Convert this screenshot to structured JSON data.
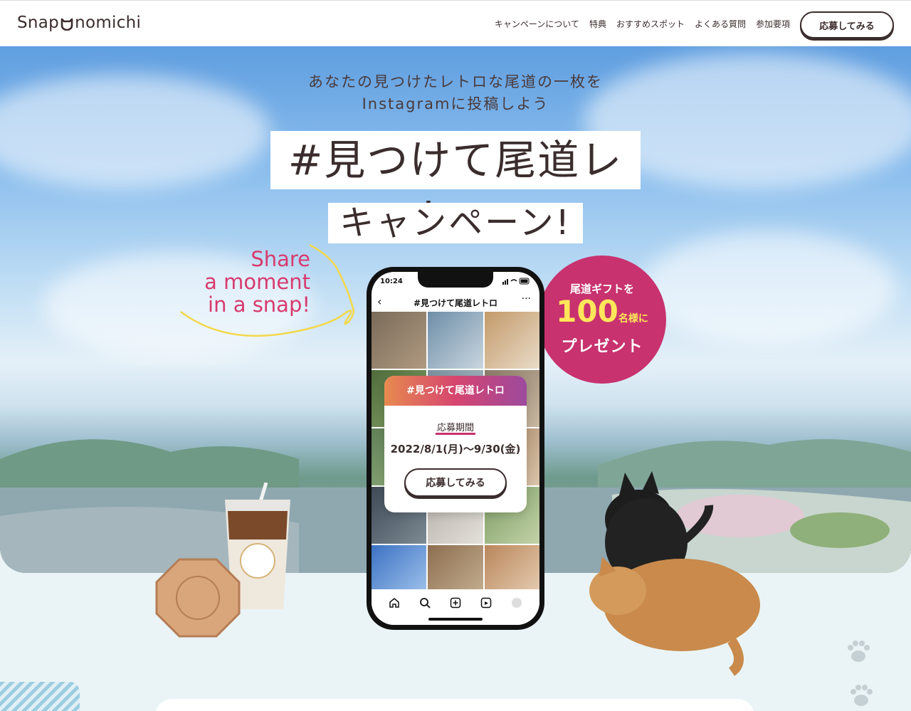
{
  "header": {
    "logo": "Snap",
    "logo_suffix": "nomichi",
    "nav": [
      "キャンペーンについて",
      "特典",
      "おすすめスポット",
      "よくある質問",
      "参加要項"
    ],
    "cta": "応募してみる"
  },
  "hero": {
    "tagline_line1": "あなたの見つけたレトロな尾道の一枚を",
    "tagline_line2": "Instagramに投稿しよう",
    "title_line1": "#見つけて尾道レトロ",
    "title_line2": "キャンペーン!",
    "share_line1": "Share",
    "share_line2": "a moment",
    "share_line3": "in a snap!"
  },
  "badge": {
    "line1": "尾道ギフトを",
    "number": "100",
    "suffix": "名様に",
    "line3": "プレゼント"
  },
  "phone": {
    "time": "10:24",
    "header_title": "#見つけて尾道レトロ",
    "back_icon": "chevron-left-icon",
    "more_icon": "more-icon",
    "nav_icons": [
      "home-icon",
      "search-icon",
      "add-post-icon",
      "reels-icon",
      "profile-icon"
    ]
  },
  "card": {
    "title": "#見つけて尾道レトロ",
    "label": "応募期間",
    "date": "2022/8/1(月)〜9/30(金)",
    "cta": "応募してみる"
  },
  "colors": {
    "brand_dark": "#3b2d2d",
    "accent_pink": "#c8326e",
    "badge_yellow": "#ffe65a",
    "share_pink": "#d83a6e"
  }
}
